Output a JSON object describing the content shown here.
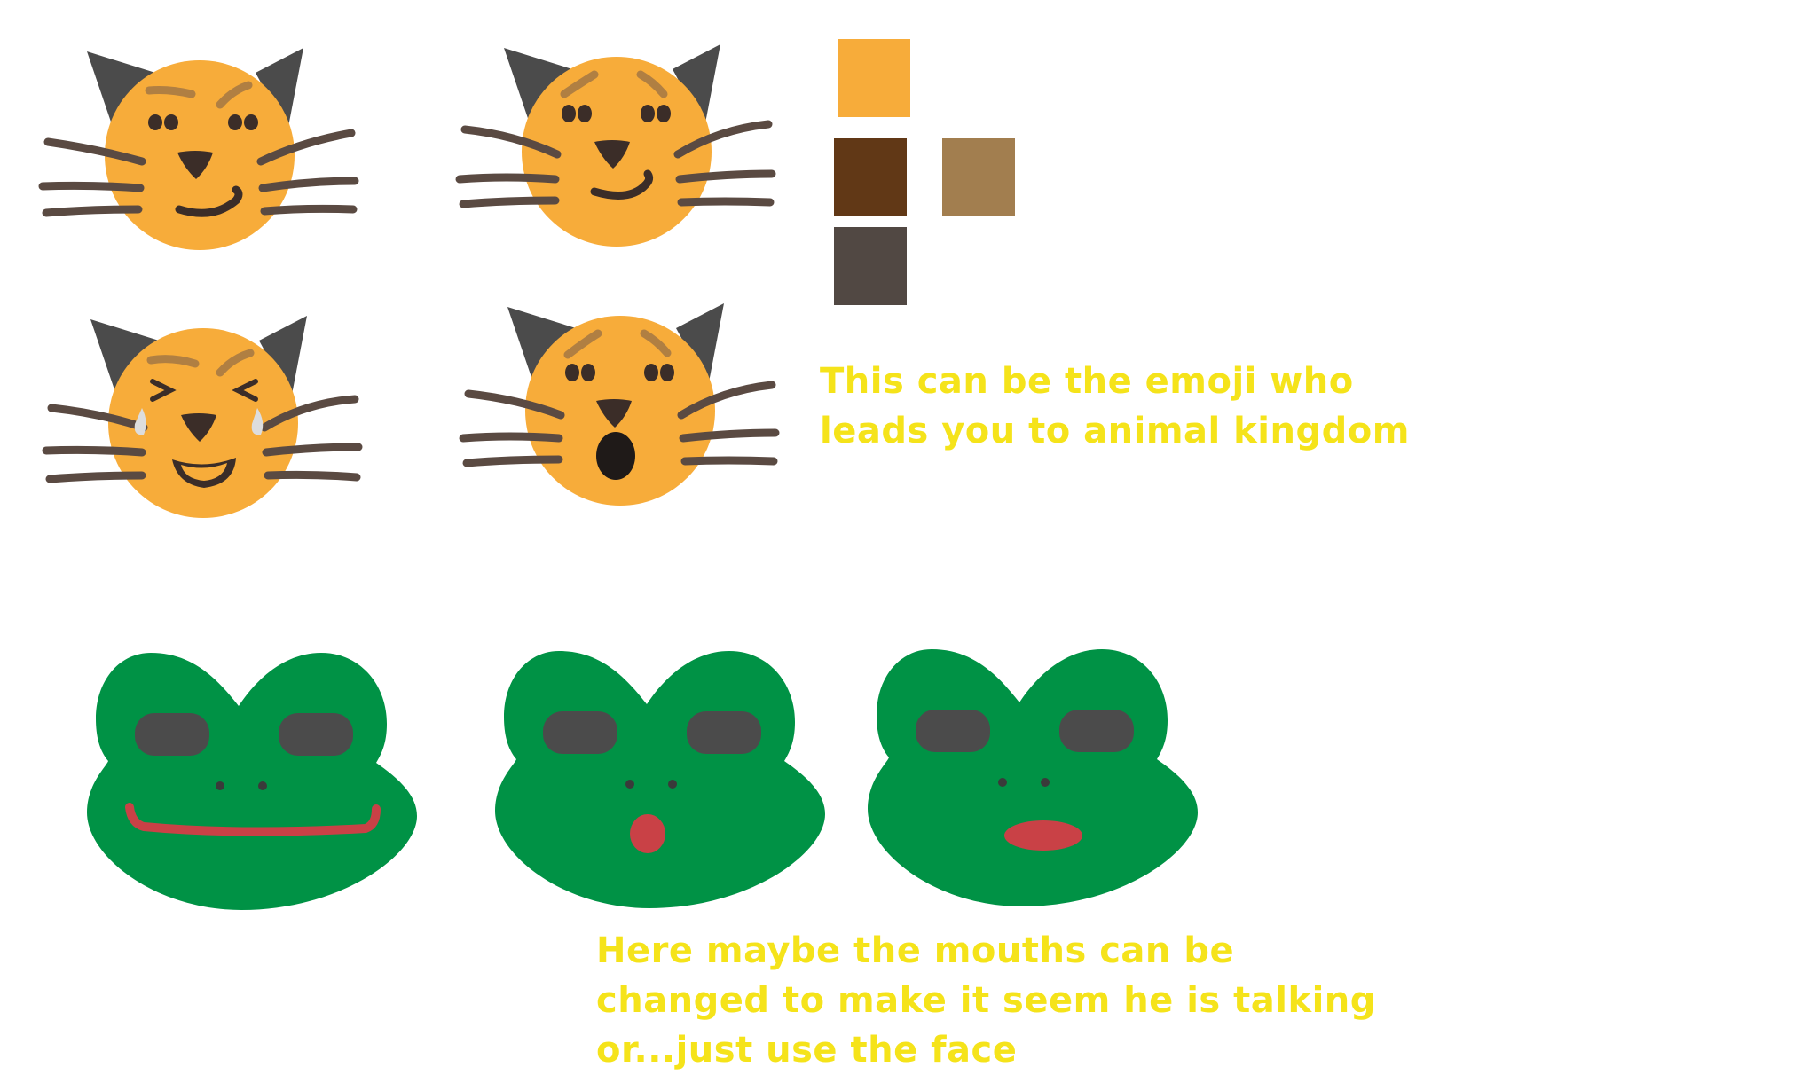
{
  "palette": {
    "title": "",
    "swatches": [
      {
        "name": "orange",
        "hex": "#F7AC3A"
      },
      {
        "name": "dark-brown",
        "hex": "#613816"
      },
      {
        "name": "light-brown",
        "hex": "#A27E4F"
      },
      {
        "name": "charcoal",
        "hex": "#514843"
      }
    ]
  },
  "colors": {
    "cat_face": "#F7AC3A",
    "cat_ears": "#4B4B4B",
    "cat_whiskers": "#5A4A42",
    "cat_brows": "#B07F42",
    "cat_features": "#3B2D28",
    "frog_skin": "#009245",
    "frog_eyes": "#4B4B4B",
    "frog_mouth": "#C94146",
    "tear": "#DDDDDD",
    "note_text": "#F5E31A"
  },
  "cats": [
    {
      "expression": "smirk"
    },
    {
      "expression": "worried-smile"
    },
    {
      "expression": "laugh-crying"
    },
    {
      "expression": "surprised"
    }
  ],
  "frogs": [
    {
      "mouth": "wide-smile"
    },
    {
      "mouth": "small-round"
    },
    {
      "mouth": "pursed-lips"
    }
  ],
  "notes": {
    "cat_note": {
      "lines": [
        "This can be the emoji who",
        "leads you to animal kingdom"
      ]
    },
    "frog_note": {
      "lines": [
        "Here maybe the mouths can be",
        "changed to make it seem he is talking",
        "or...just use the face"
      ]
    }
  }
}
